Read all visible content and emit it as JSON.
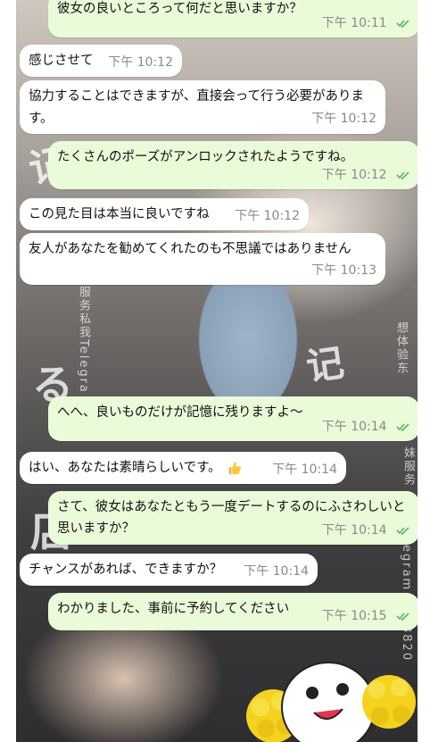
{
  "colors": {
    "incoming_bubble": "#ffffff",
    "outgoing_bubble": "#eafbd9",
    "timestamp": "#8a8a8a",
    "read_check": "#5bb56a"
  },
  "watermarks": {
    "left_vertical": "服务私我Telegra",
    "right_vertical_1": "想体验东",
    "right_vertical_2": "妹服务",
    "right_vertical_3": "egram",
    "right_vertical_4": "3820",
    "big_chars": [
      "记",
      "る",
      "店",
      "记"
    ]
  },
  "messages": [
    {
      "dir": "out",
      "text": "彼女の良いところって何だと思いますか？",
      "time": "下午 10:11",
      "read": true
    },
    {
      "dir": "in",
      "text": "感じさせて",
      "time": "下午 10:12"
    },
    {
      "dir": "in",
      "text": "協力することはできますが、直接会って行う必要があります。",
      "time": "下午 10:12"
    },
    {
      "dir": "out",
      "text": "たくさんのポーズがアンロックされたようですね。",
      "time": "下午 10:12",
      "read": true
    },
    {
      "dir": "in",
      "text": "この見た目は本当に良いですね",
      "time": "下午 10:12"
    },
    {
      "dir": "in",
      "text": "友人があなたを勧めてくれたのも不思議ではありません",
      "time": "下午 10:13"
    },
    {
      "dir": "out",
      "text": "へへ、良いものだけが記憶に残りますよ～",
      "time": "下午 10:14",
      "read": true
    },
    {
      "dir": "in",
      "text": "はい、あなたは素晴らしいです。",
      "emoji": "thumbs-up-emoji",
      "time": "下午 10:14"
    },
    {
      "dir": "out",
      "text": "さて、彼女はあなたともう一度デートするのにふさわしいと思いますか？",
      "time": "下午 10:14",
      "read": true
    },
    {
      "dir": "in",
      "text": "チャンスがあれば、できますか？",
      "time": "下午 10:14"
    },
    {
      "dir": "out",
      "text": "わかりました、事前に予約してください",
      "time": "下午 10:15",
      "read": true
    }
  ]
}
